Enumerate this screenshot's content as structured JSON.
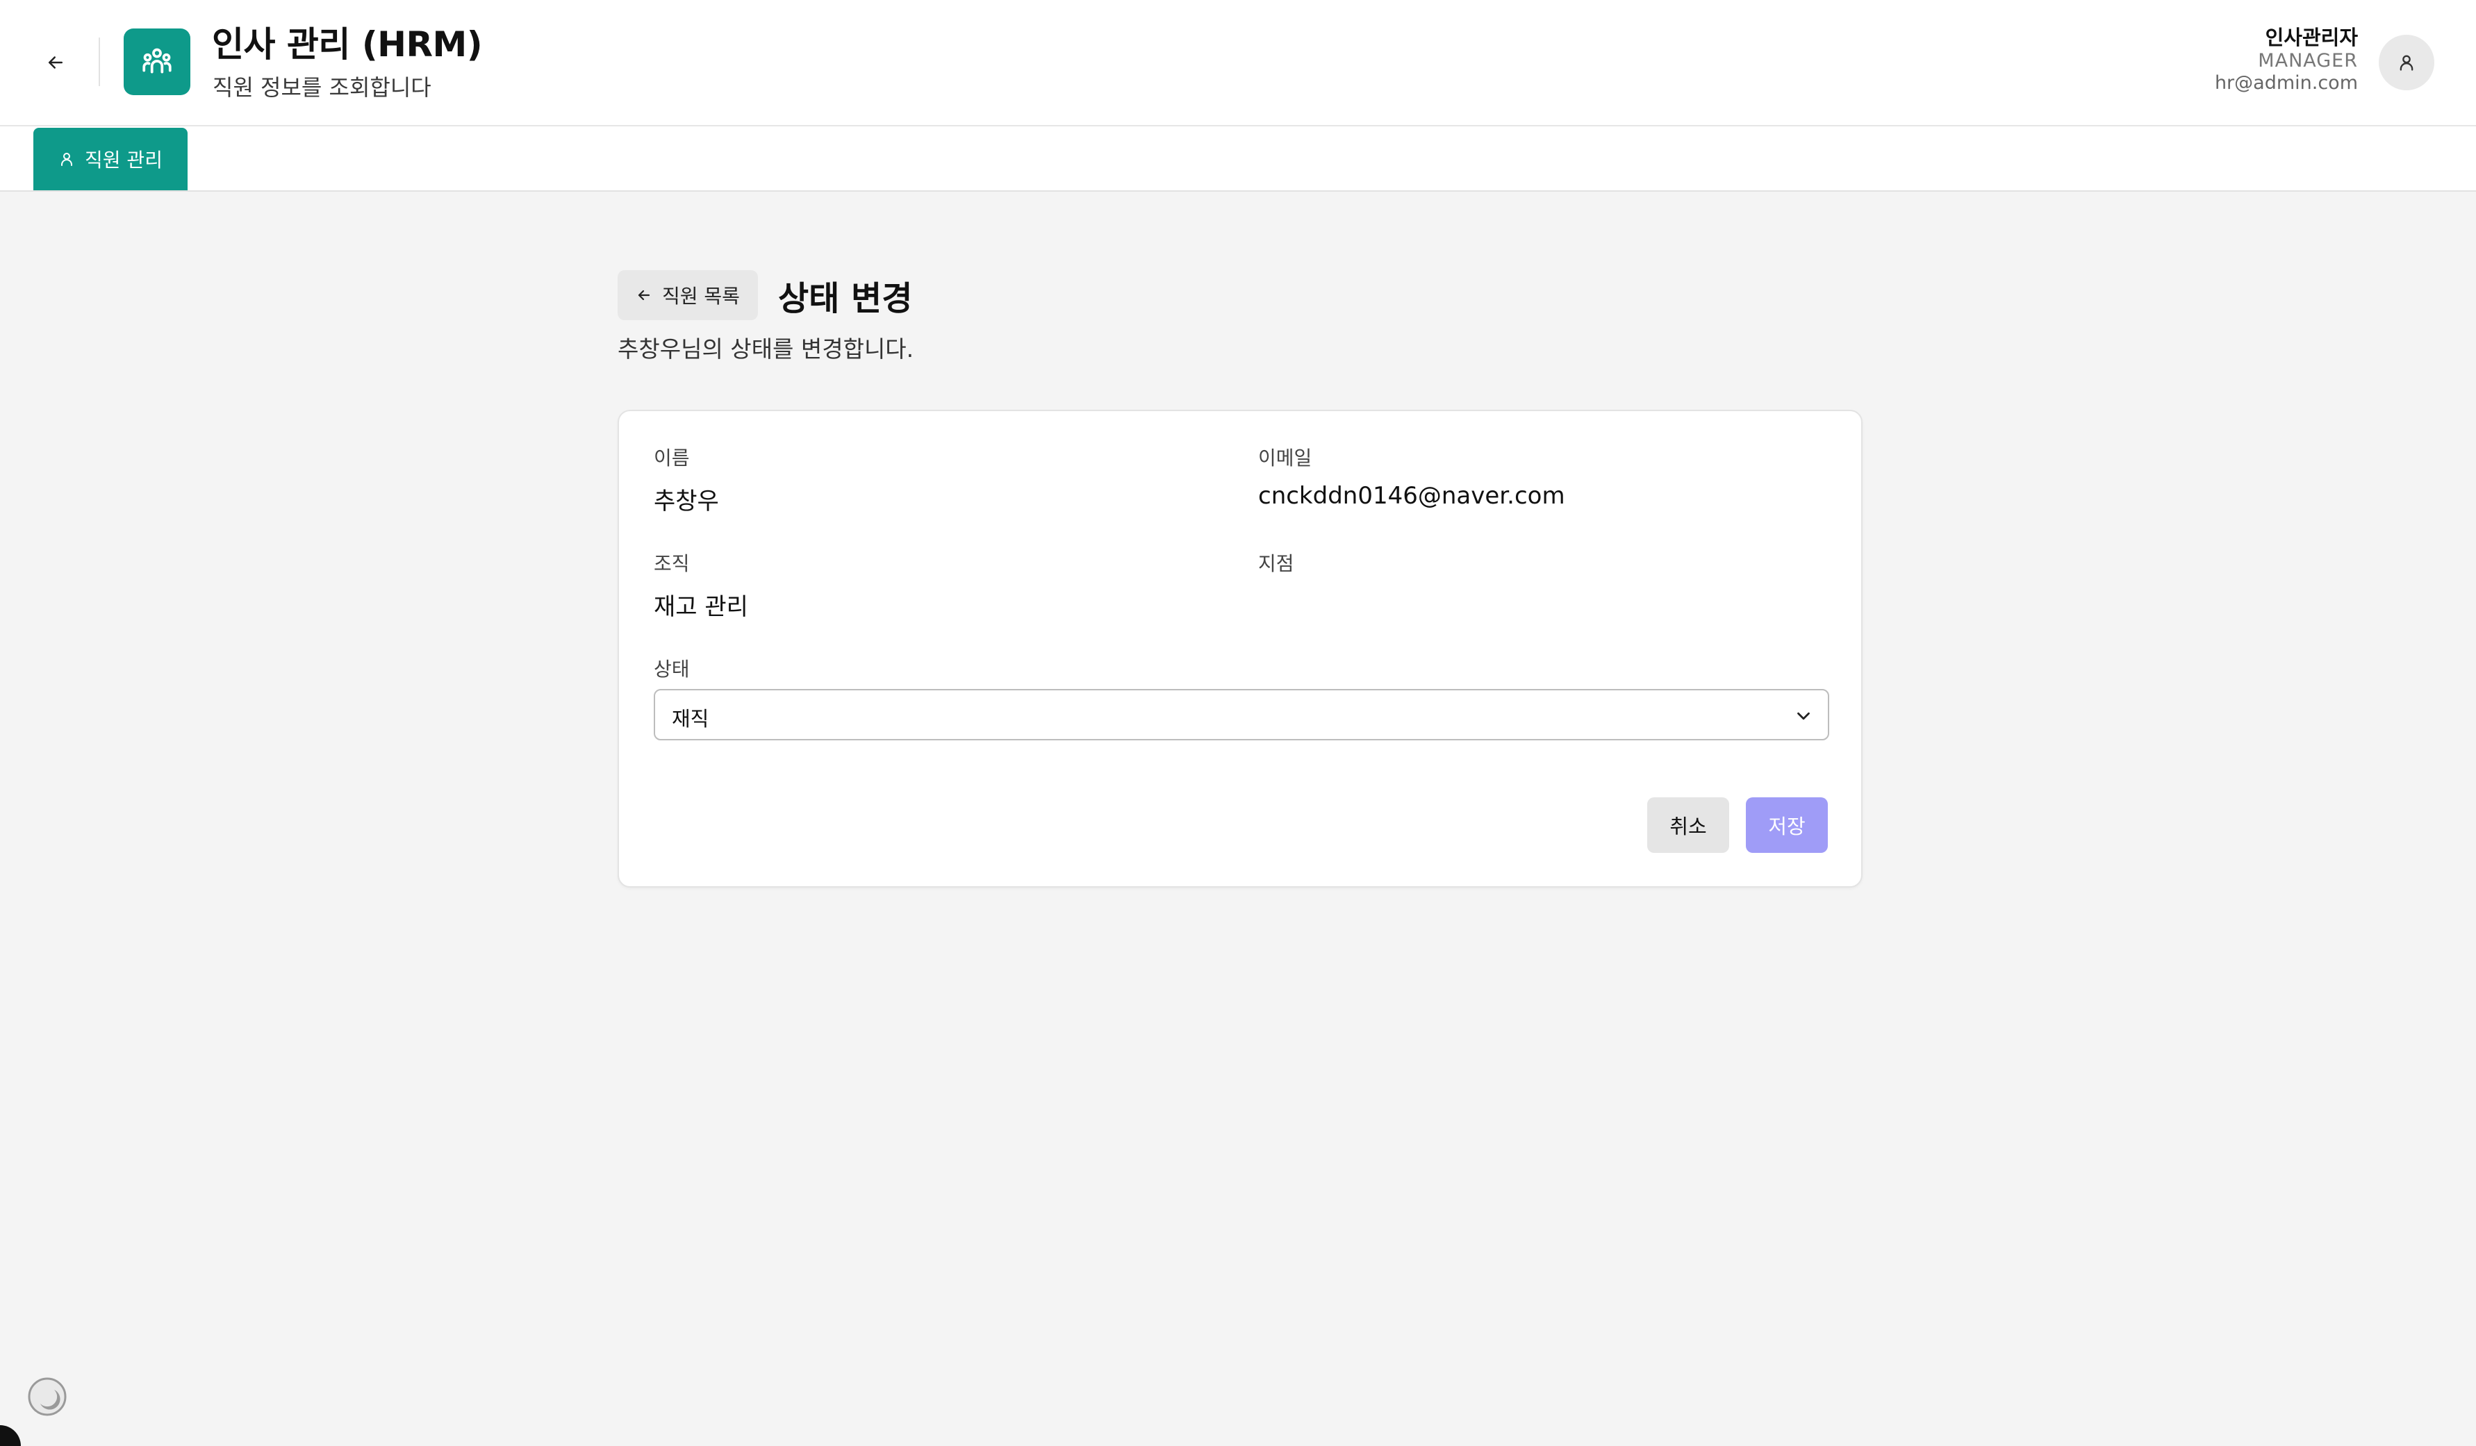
{
  "header": {
    "app_title": "인사 관리 (HRM)",
    "app_subtitle": "직원 정보를 조회합니다",
    "back_icon": "arrow-left-icon",
    "logo_icon": "people-group-icon",
    "accent_color": "#0e9a8a"
  },
  "user": {
    "name": "인사관리자",
    "role": "MANAGER",
    "email": "hr@admin.com",
    "avatar_icon": "user-icon"
  },
  "tabs": [
    {
      "label": "직원 관리",
      "icon": "user-icon",
      "active": true
    }
  ],
  "page": {
    "back_to_list_label": "직원 목록",
    "title": "상태 변경",
    "description": "추창우님의 상태를 변경합니다."
  },
  "form": {
    "name_label": "이름",
    "name_value": "추창우",
    "email_label": "이메일",
    "email_value": "cnckddn0146@naver.com",
    "org_label": "조직",
    "org_value": "재고 관리",
    "branch_label": "지점",
    "branch_value": "",
    "status_label": "상태",
    "status_value": "재직",
    "cancel_label": "취소",
    "save_label": "저장",
    "save_color": "#9f9cf7"
  },
  "footer": {
    "theme_toggle_icon": "moon-icon"
  }
}
